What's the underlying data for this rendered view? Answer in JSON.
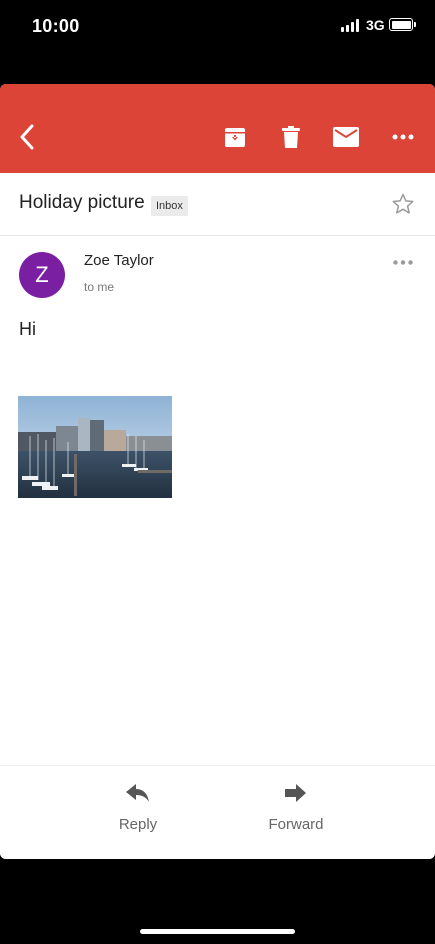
{
  "status_bar": {
    "time": "10:00",
    "network": "3G"
  },
  "toolbar": {
    "background_color": "#DB4437"
  },
  "email": {
    "subject": "Holiday picture",
    "label": "Inbox",
    "sender": {
      "name": "Zoe Taylor",
      "initial": "Z",
      "avatar_color": "#7B1FA2",
      "recipient": "to me"
    },
    "body": "Hi",
    "attachment": {
      "type": "image",
      "description_icon": "photo-thumbnail"
    }
  },
  "actions": {
    "reply_label": "Reply",
    "forward_label": "Forward"
  },
  "icons": {
    "back": "chevron-left-icon",
    "archive": "archive-icon",
    "delete": "trash-icon",
    "mark_unread": "envelope-icon",
    "more": "more-horizontal-icon",
    "star": "star-outline-icon",
    "reply": "reply-arrow-icon",
    "forward": "forward-arrow-icon"
  }
}
